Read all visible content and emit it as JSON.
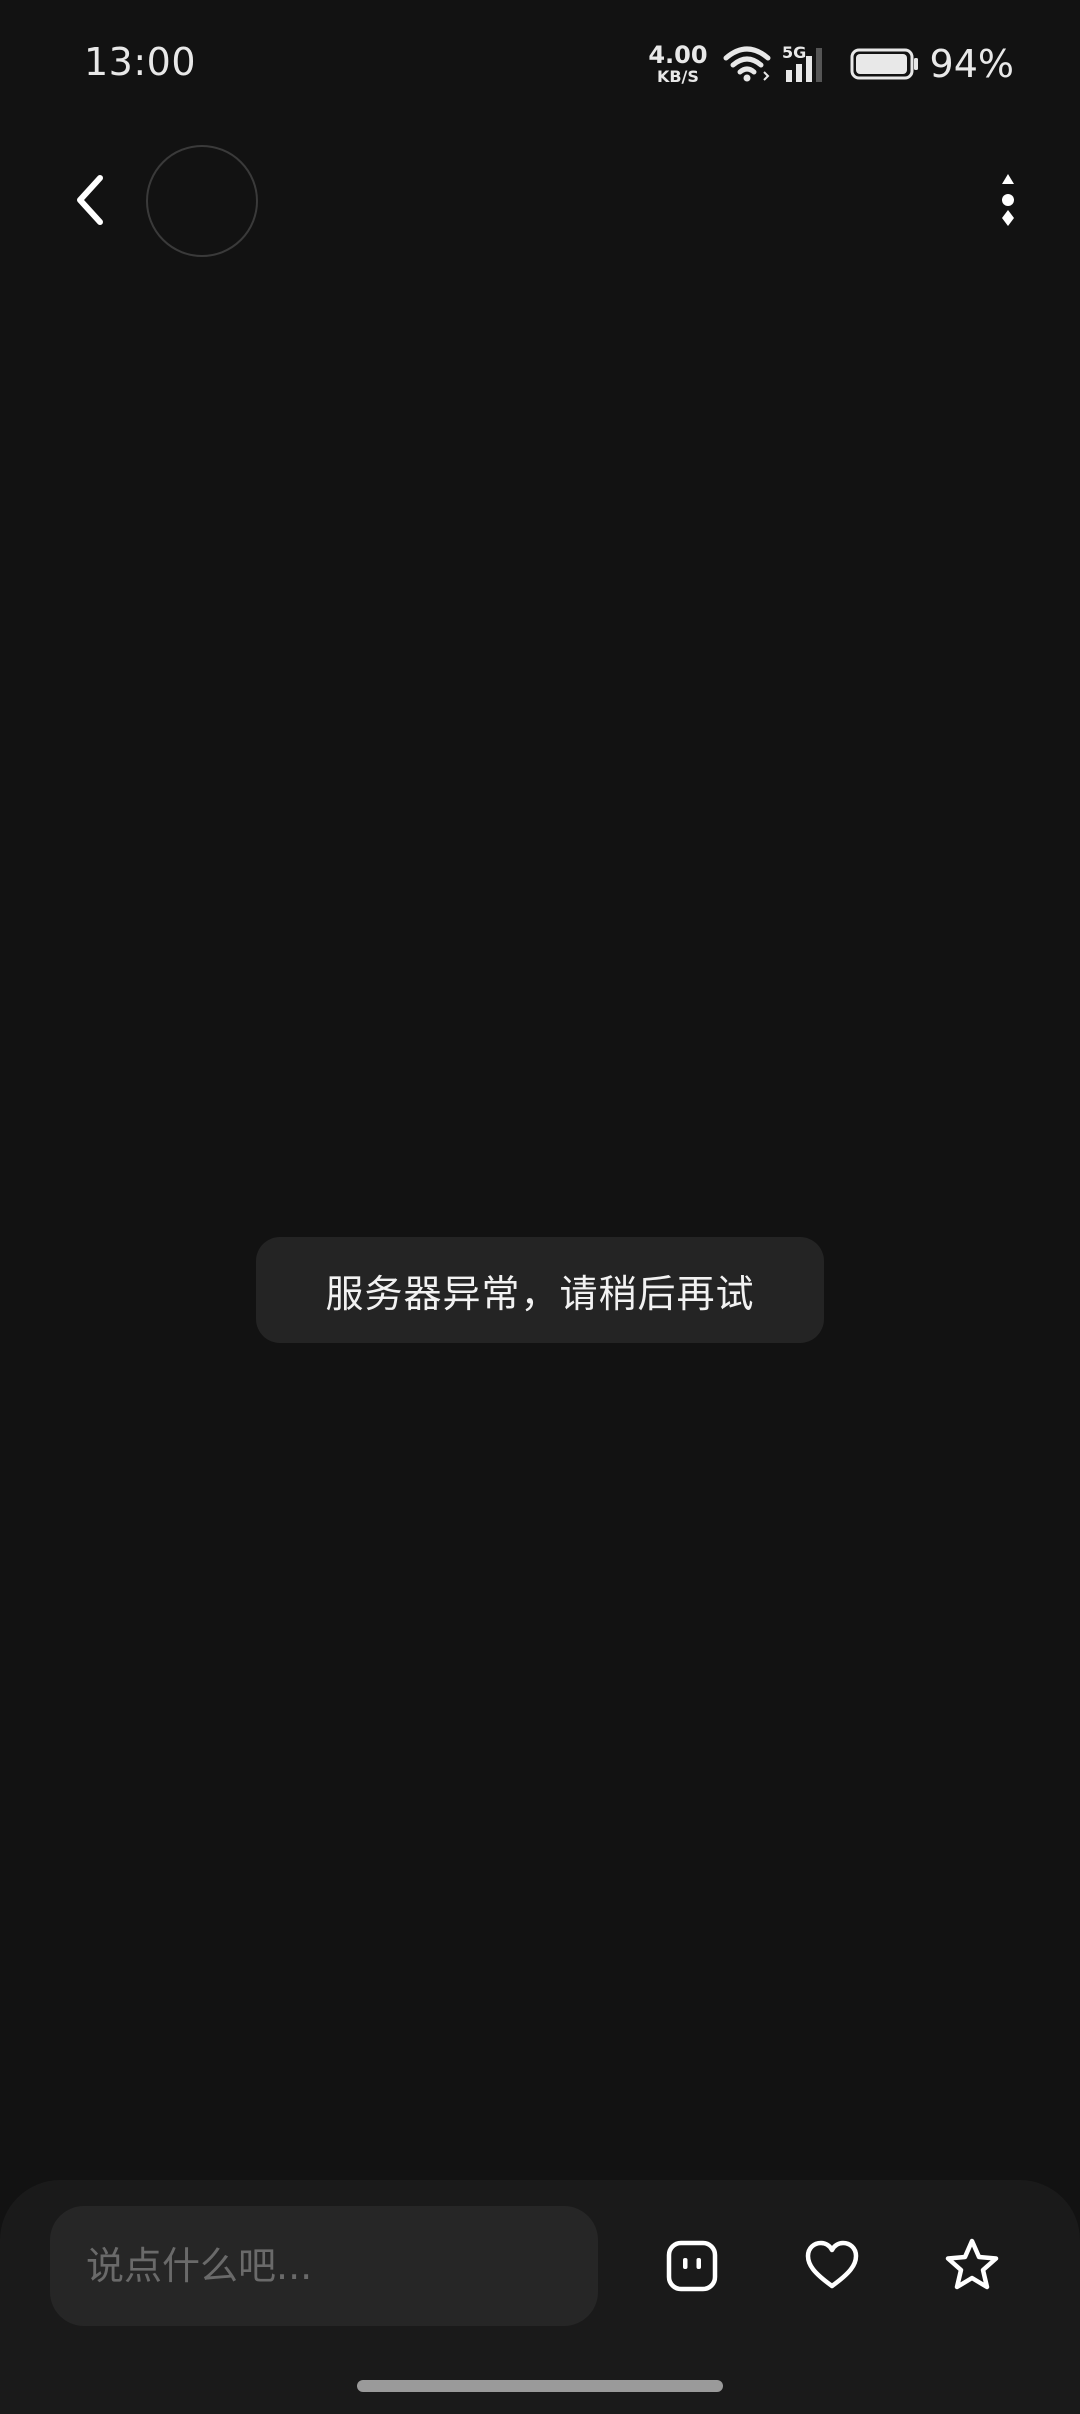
{
  "status_bar": {
    "time": "13:00",
    "net_speed_value": "4.00",
    "net_speed_unit": "KB/S",
    "network_type": "5G",
    "battery_percent": "94%",
    "battery_level": 0.94,
    "icons": [
      "wifi-icon",
      "signal-icon",
      "battery-icon"
    ]
  },
  "header": {
    "back_icon": "chevron-left-icon",
    "more_icon": "more-vertical-icon"
  },
  "toast": {
    "message": "服务器异常，请稍后再试"
  },
  "bottom_bar": {
    "input_placeholder": "说点什么吧...",
    "input_value": "",
    "actions": [
      "emoji-icon",
      "heart-icon",
      "star-icon"
    ]
  },
  "colors": {
    "background": "#121212",
    "toast_bg": "#242424",
    "bottom_bar_bg": "#1a1a1a",
    "input_bg": "#262626"
  }
}
